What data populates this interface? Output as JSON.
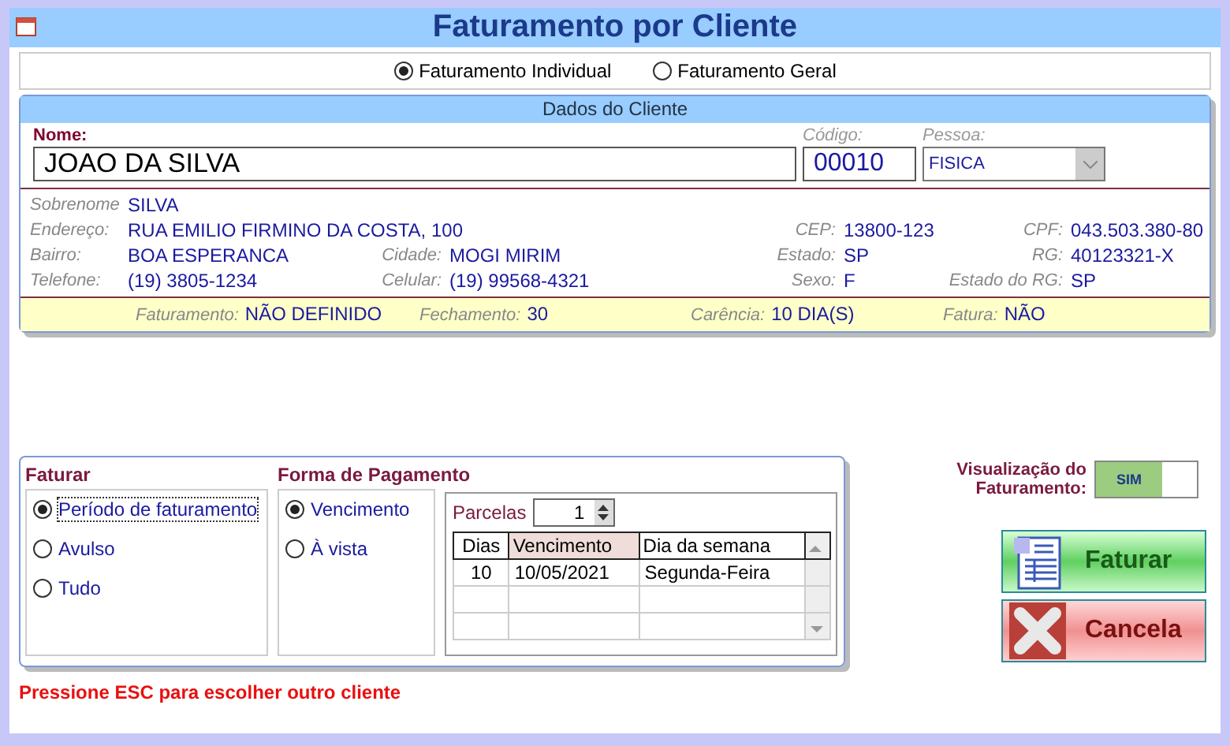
{
  "window": {
    "title": "Faturamento por Cliente"
  },
  "mode_options": [
    {
      "label": "Faturamento Individual",
      "selected": true
    },
    {
      "label": "Faturamento Geral",
      "selected": false
    }
  ],
  "client_panel": {
    "title": "Dados do Cliente",
    "name": {
      "label": "Nome:",
      "value": "JOAO DA SILVA"
    },
    "code": {
      "label": "Código:",
      "value": "00010"
    },
    "person": {
      "label": "Pessoa:",
      "value": "FISICA"
    },
    "details": [
      [
        {
          "label": "Sobrenome",
          "value": "SILVA"
        }
      ],
      [
        {
          "label": "Endereço:",
          "value": "RUA EMILIO FIRMINO DA COSTA, 100"
        },
        {
          "label": "CEP:",
          "value": "13800-123"
        },
        {
          "label": "CPF:",
          "value": "043.503.380-80"
        }
      ],
      [
        {
          "label": "Bairro:",
          "value": "BOA ESPERANCA"
        },
        {
          "label": "Cidade:",
          "value": "MOGI MIRIM"
        },
        {
          "label": "Estado:",
          "value": "SP"
        },
        {
          "label": "RG:",
          "value": "40123321-X"
        }
      ],
      [
        {
          "label": "Telefone:",
          "value": "(19) 3805-1234"
        },
        {
          "label": "Celular:",
          "value": "(19) 99568-4321"
        },
        {
          "label": "Sexo:",
          "value": "F"
        },
        {
          "label": "Estado do RG:",
          "value": "SP"
        }
      ]
    ],
    "billing": [
      {
        "label": "Faturamento:",
        "value": "NÃO DEFINIDO"
      },
      {
        "label": "Fechamento:",
        "value": "30"
      },
      {
        "label": "Carência:",
        "value": "10 DIA(S)"
      },
      {
        "label": "Fatura:",
        "value": "NÃO"
      }
    ]
  },
  "faturar": {
    "title": "Faturar",
    "options": [
      {
        "label": "Período de faturamento",
        "selected": true
      },
      {
        "label": "Avulso",
        "selected": false
      },
      {
        "label": "Tudo",
        "selected": false
      }
    ]
  },
  "payment": {
    "title": "Forma de Pagamento",
    "options": [
      {
        "label": "Vencimento",
        "selected": true
      },
      {
        "label": "À vista",
        "selected": false
      }
    ],
    "installments": {
      "label": "Parcelas",
      "value": "1"
    },
    "table": {
      "columns": [
        "Dias",
        "Vencimento",
        "Dia da semana"
      ],
      "rows": [
        [
          "10",
          "10/05/2021",
          "Segunda-Feira"
        ]
      ]
    }
  },
  "preview": {
    "label": "Visualização do Faturamento:",
    "toggle": "SIM",
    "on": true
  },
  "buttons": [
    {
      "label": "Faturar",
      "kind": "invoice"
    },
    {
      "label": "Cancela",
      "kind": "cancel"
    }
  ],
  "hint": "Pressione ESC para escolher outro cliente"
}
